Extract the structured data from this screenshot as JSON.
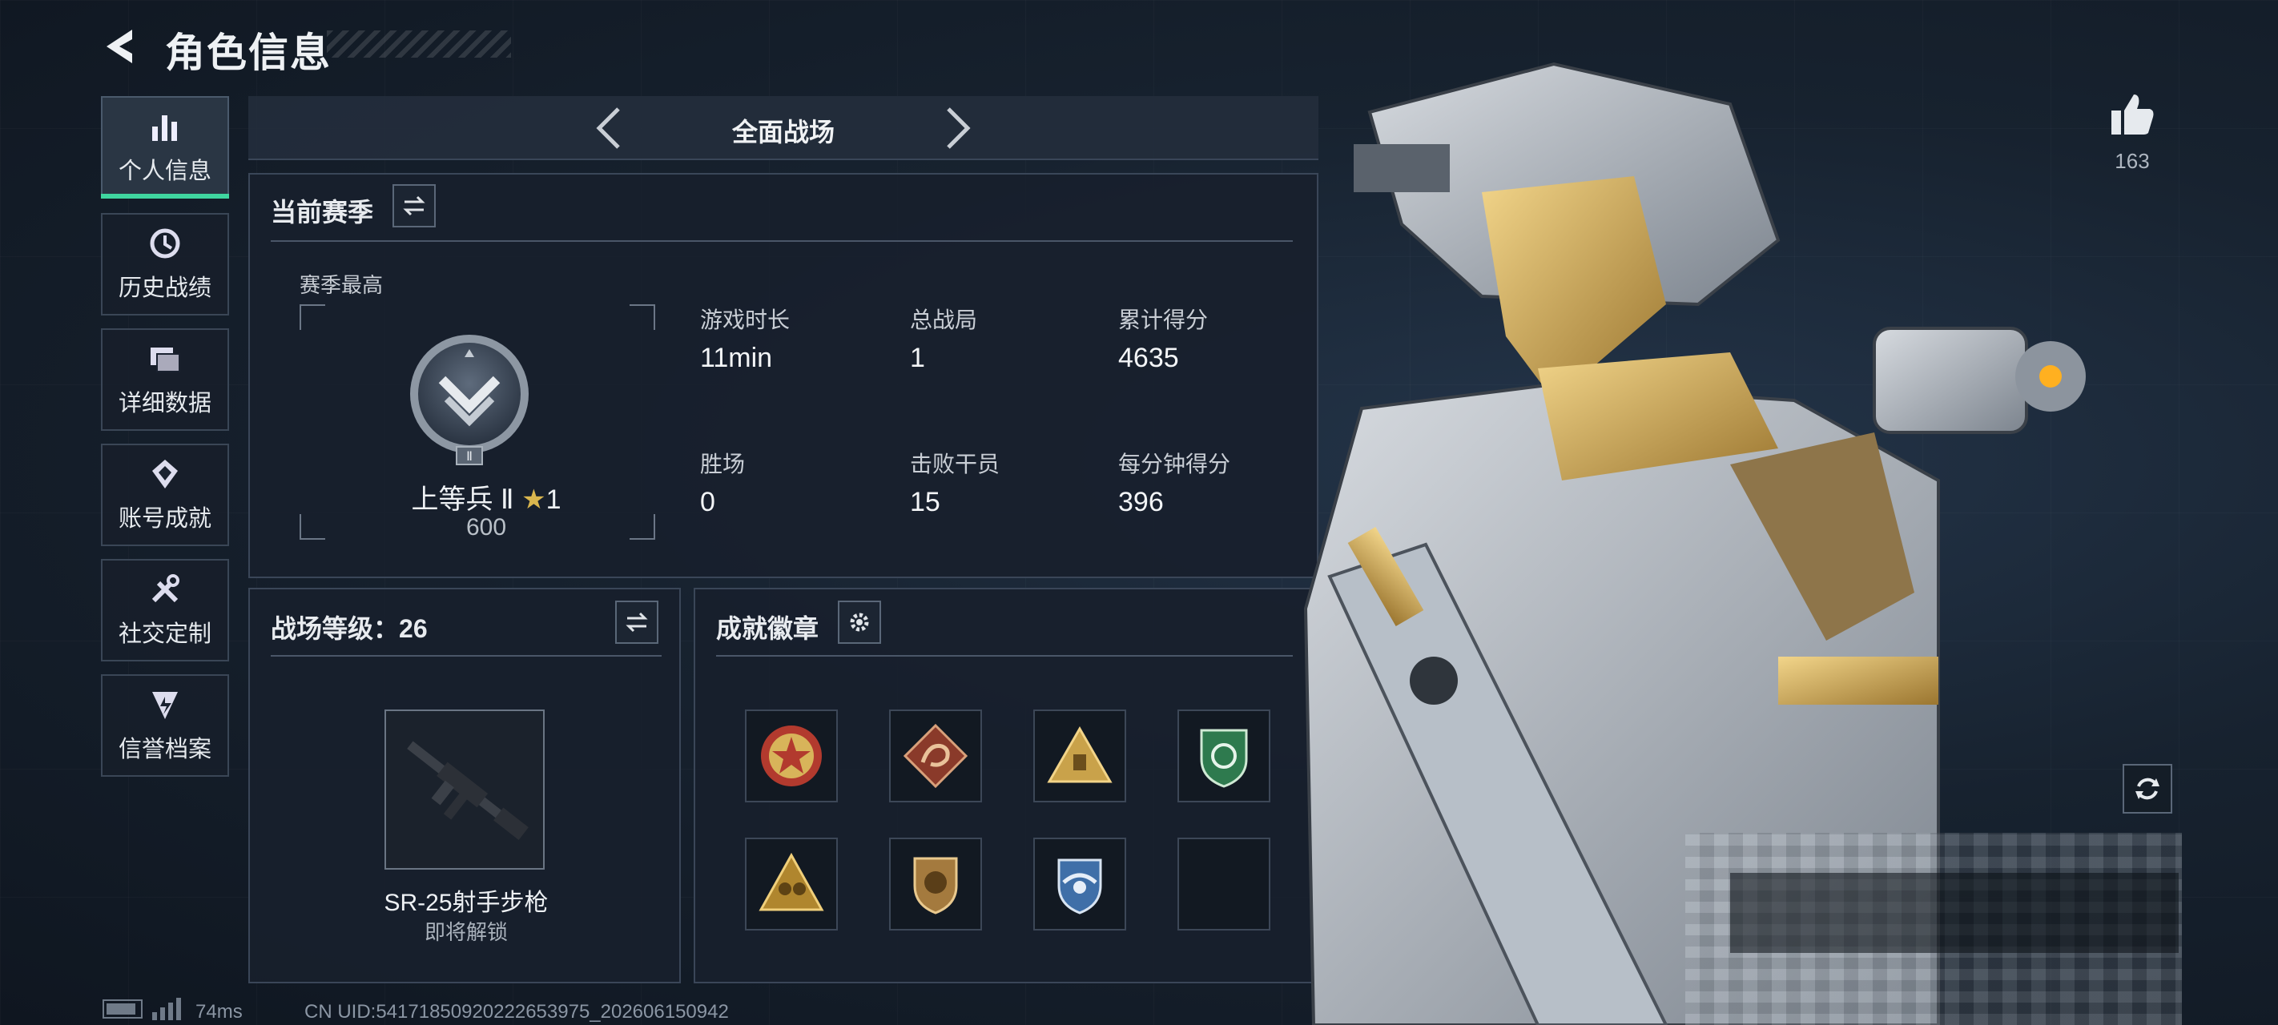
{
  "header": {
    "title": "角色信息"
  },
  "sidebar": {
    "items": [
      {
        "label": "个人信息",
        "active": true,
        "icon": "bar-chart-icon"
      },
      {
        "label": "历史战绩",
        "active": false,
        "icon": "history-clock-icon"
      },
      {
        "label": "详细数据",
        "active": false,
        "icon": "folder-stack-icon"
      },
      {
        "label": "账号成就",
        "active": false,
        "icon": "achievement-medal-icon"
      },
      {
        "label": "社交定制",
        "active": false,
        "icon": "tools-wrench-icon"
      },
      {
        "label": "信誉档案",
        "active": false,
        "icon": "reputation-shield-icon"
      }
    ]
  },
  "mode_bar": {
    "label": "全面战场"
  },
  "season": {
    "title": "当前赛季",
    "best_label": "赛季最高",
    "rank_name": "上等兵 Ⅱ",
    "rank_stars": "1",
    "rank_points": "600",
    "rank_badge_numeral": "Ⅱ",
    "stats": [
      {
        "label": "游戏时长",
        "value": "11min"
      },
      {
        "label": "总战局",
        "value": "1"
      },
      {
        "label": "累计得分",
        "value": "4635"
      },
      {
        "label": "胜场",
        "value": "0"
      },
      {
        "label": "击败干员",
        "value": "15"
      },
      {
        "label": "每分钟得分",
        "value": "396"
      }
    ]
  },
  "battlefield_level": {
    "title_prefix": "战场等级：",
    "level": "26",
    "weapon_name": "SR-25射手步枪",
    "weapon_status": "即将解锁"
  },
  "achievements": {
    "title": "成就徽章",
    "badges": [
      {
        "icon": "red-star-crest-icon",
        "color": "#b23a2e"
      },
      {
        "icon": "red-dragon-badge-icon",
        "color": "#8a3a2a"
      },
      {
        "icon": "gold-triangle-badge-icon",
        "color": "#c9a24a"
      },
      {
        "icon": "green-shield-badge-icon",
        "color": "#2e7a4e"
      },
      {
        "icon": "gold-warriors-badge-icon",
        "color": "#b0862e"
      },
      {
        "icon": "lion-shield-badge-icon",
        "color": "#a47a3e"
      },
      {
        "icon": "blue-winged-shield-icon",
        "color": "#3f6fa8"
      },
      {
        "icon": "empty-slot",
        "color": ""
      }
    ]
  },
  "likes": {
    "count": "163"
  },
  "footer": {
    "ping": "74ms",
    "uid": "CN UID:54171850920222653975_202606150942"
  },
  "colors": {
    "accent": "#3fd6a0",
    "panel": "#18202c",
    "border": "#3a4658"
  }
}
